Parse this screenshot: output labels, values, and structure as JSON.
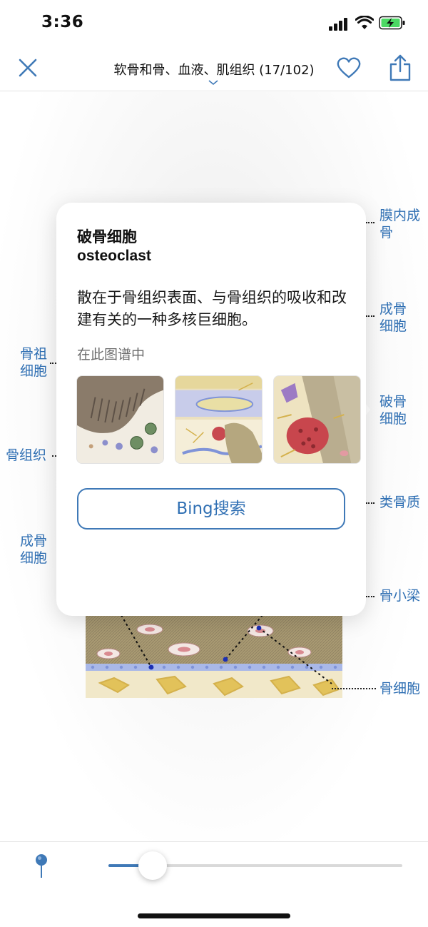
{
  "status": {
    "time": "3:36"
  },
  "nav": {
    "title": "软骨和骨、血液、肌组织 (17/102)"
  },
  "labels": {
    "right": [
      "膜内成",
      "骨",
      "成骨",
      "细胞",
      "破骨",
      "细胞",
      "类骨质",
      "骨小梁",
      "骨细胞"
    ],
    "left": [
      "骨祖",
      "细胞",
      "骨组织",
      "成骨",
      "细胞"
    ]
  },
  "popover": {
    "title_cn": "破骨细胞",
    "title_en": "osteoclast",
    "description": "散在于骨组织表面、与骨组织的吸收和改建有关的一种多核巨细胞。",
    "section_label": "在此图谱中",
    "search_button": "Bing搜索"
  },
  "slider": {
    "value": 0.15
  },
  "colors": {
    "accent": "#3f79b7",
    "label": "#2f6fb3"
  },
  "icons": {
    "close": "close-icon",
    "heart": "heart-icon",
    "share": "share-icon",
    "pin": "pin-icon"
  }
}
